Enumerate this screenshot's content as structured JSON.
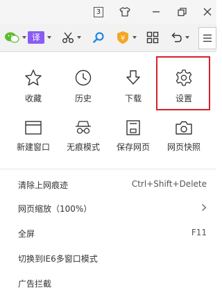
{
  "titlebar": {
    "badge_number": "3"
  },
  "toolbar": {
    "translate_label": "译",
    "coupon_label": "¥"
  },
  "menu": {
    "grid_row1": [
      {
        "label": "收藏",
        "icon": "star-icon"
      },
      {
        "label": "历史",
        "icon": "clock-icon"
      },
      {
        "label": "下载",
        "icon": "download-icon"
      },
      {
        "label": "设置",
        "icon": "gear-icon"
      }
    ],
    "grid_row2": [
      {
        "label": "新建窗口",
        "icon": "new-window-icon"
      },
      {
        "label": "无痕模式",
        "icon": "incognito-icon"
      },
      {
        "label": "保存网页",
        "icon": "save-page-icon"
      },
      {
        "label": "网页快照",
        "icon": "camera-icon"
      }
    ],
    "list": [
      {
        "label": "清除上网痕迹",
        "shortcut": "Ctrl+Shift+Delete"
      },
      {
        "label": "网页缩放（100%）",
        "shortcut": ""
      },
      {
        "label": "全屏",
        "shortcut": "F11"
      },
      {
        "label": "切换到IE6多窗口模式",
        "shortcut": ""
      },
      {
        "label": "广告拦截",
        "shortcut": ""
      }
    ]
  },
  "colors": {
    "highlight_border": "#d6202a",
    "translate_bg": "#8a5cf6",
    "search_icon": "#1e88e5",
    "coupon_bg": "#f5a623",
    "wechat_green": "#5dbb2e"
  }
}
